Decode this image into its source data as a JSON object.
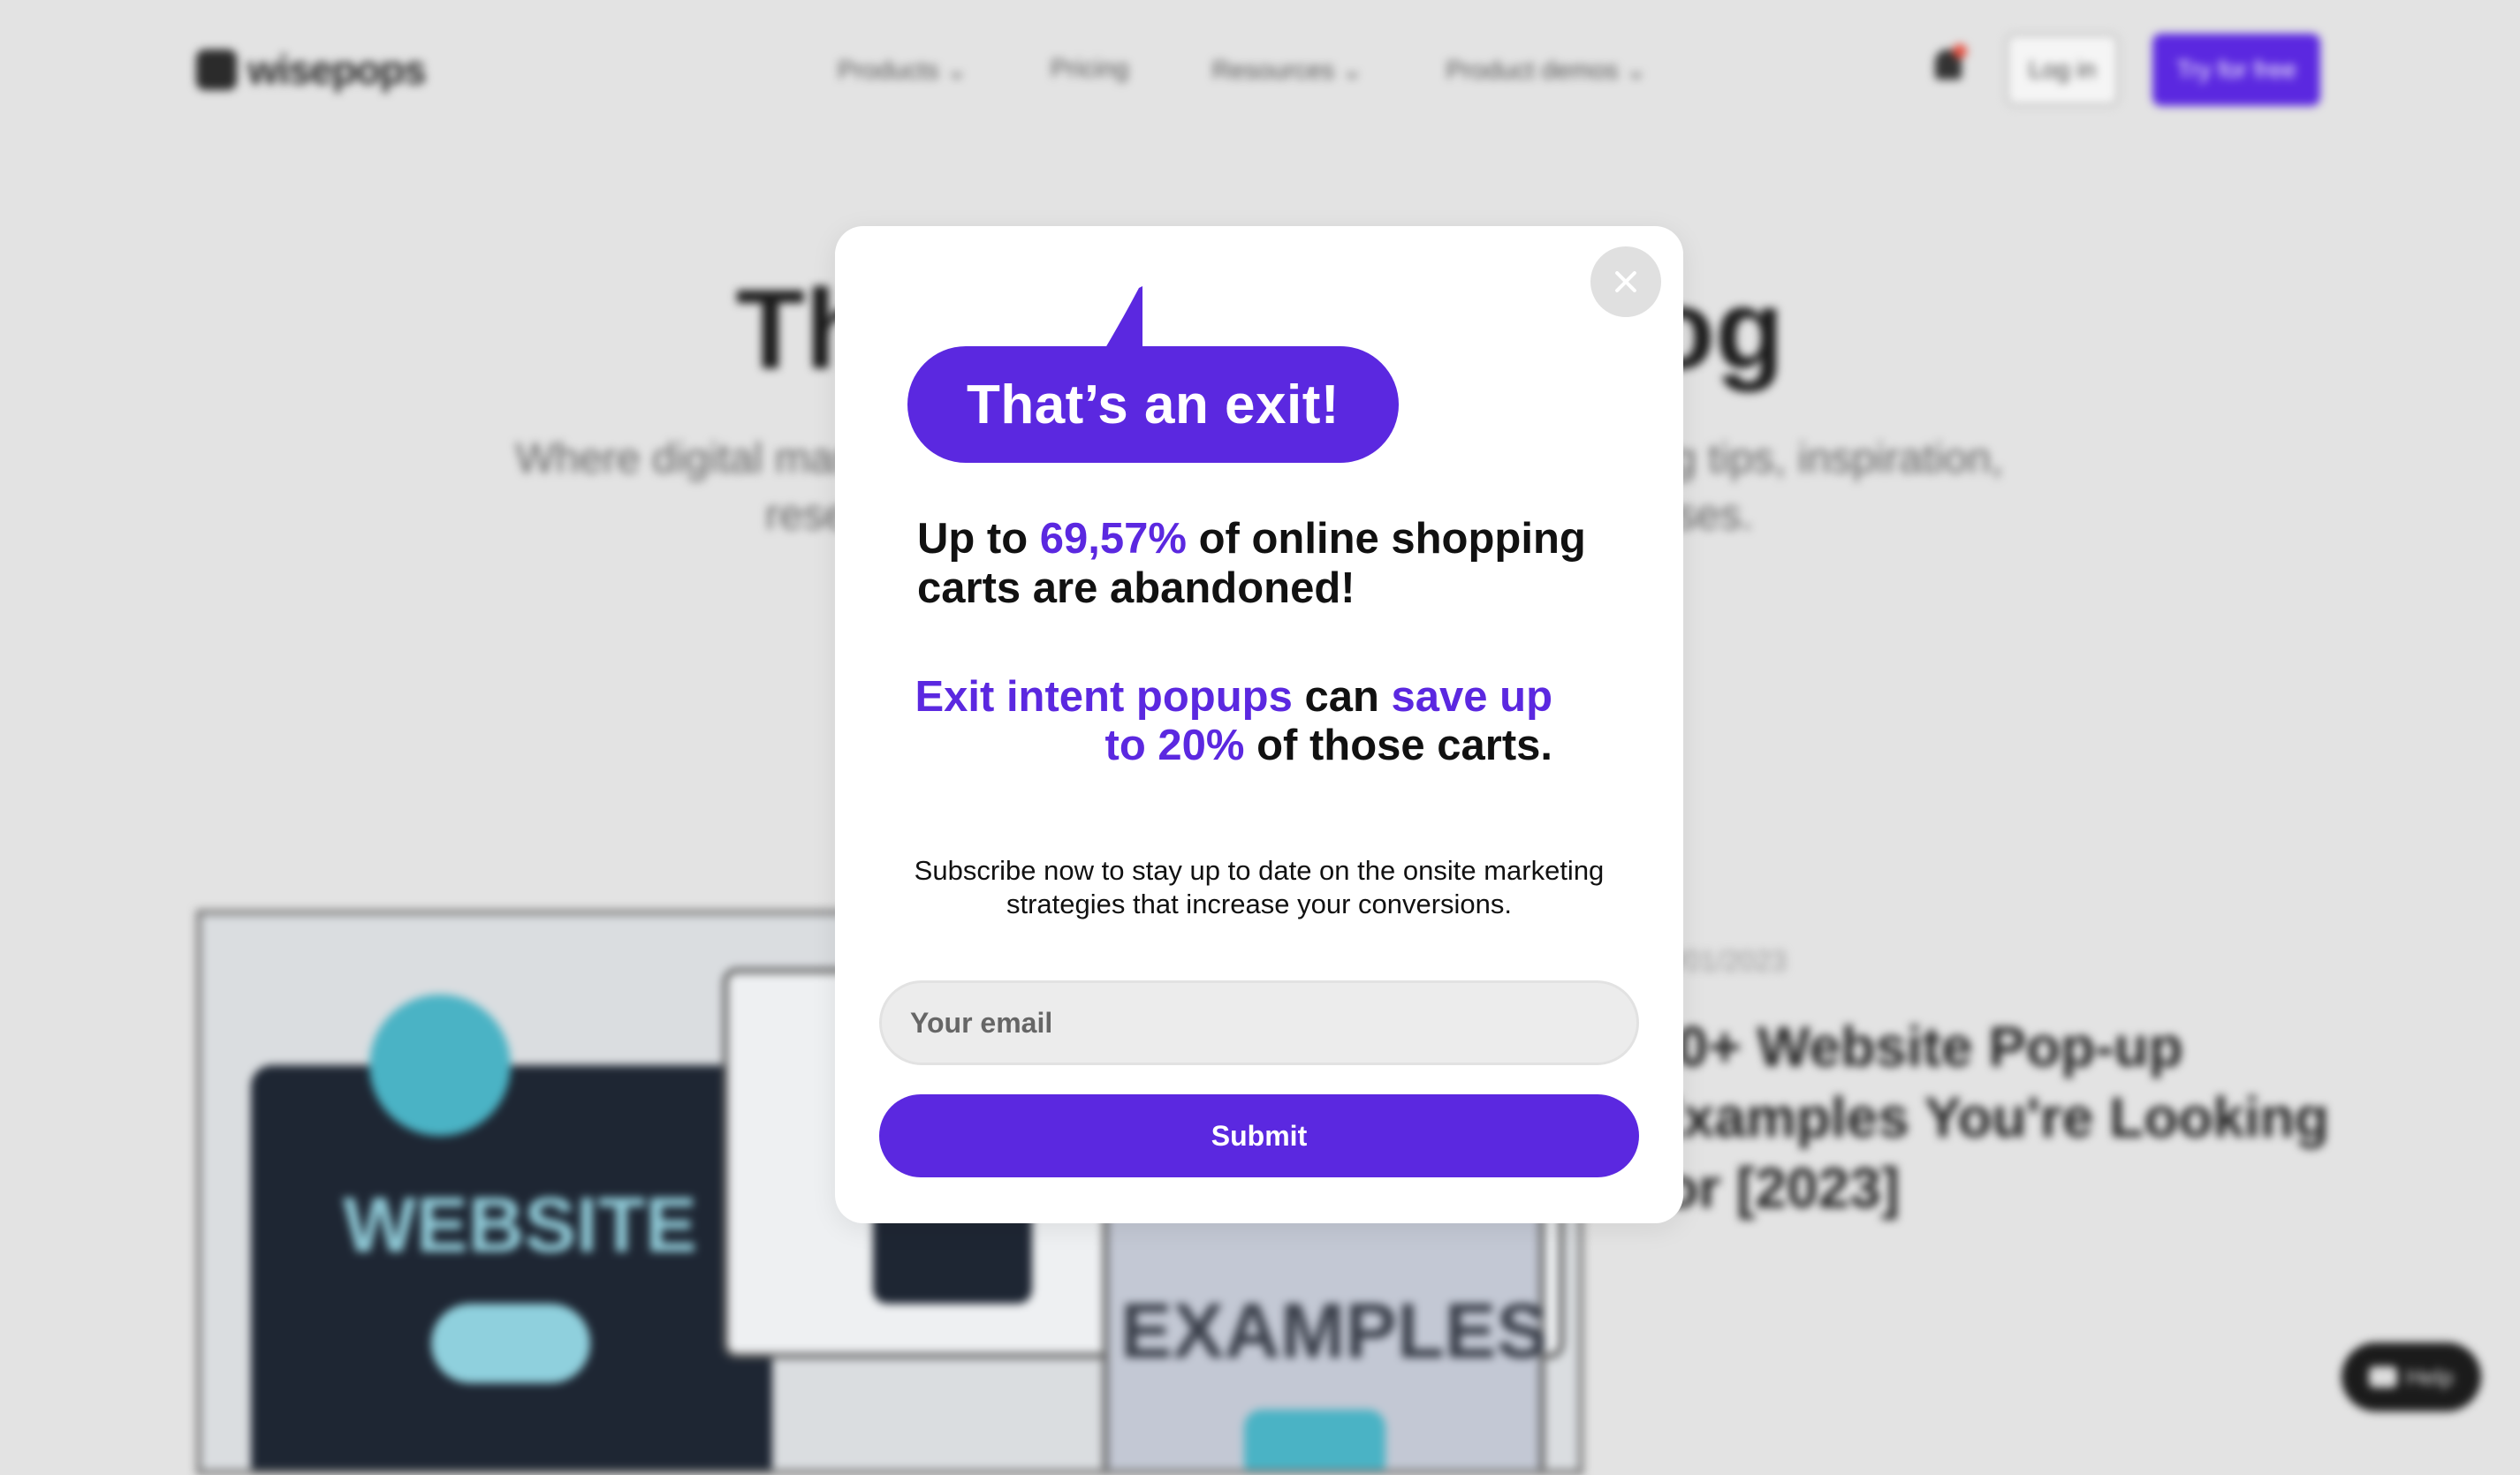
{
  "background": {
    "logo_text": "wisepops",
    "nav": [
      "Products ⌄",
      "Pricing",
      "Resources ⌄",
      "Product demos ⌄"
    ],
    "login_label": "Log in",
    "try_label": "Try for free",
    "hero_title": "The Wisepops Blog",
    "hero_subtitle": "Where digital marketers come for the freshest onsite marketing tips, inspiration, research, and case studies to grow their businesses.",
    "card_image_text_1": "WEBSITE",
    "card_image_text_2": "EXAMPLES",
    "post_date": "03/01/2023",
    "post_title": "80+ Website Pop-up Examples You're Looking for [2023]",
    "help_label": "Help"
  },
  "popup": {
    "bubble_text": "That’s an exit!",
    "stat_prefix": "Up to ",
    "stat_highlight": "69,57%",
    "stat_suffix": " of online shopping carts are abandoned!",
    "save_highlight_1": "Exit intent popups",
    "save_middle": " can ",
    "save_highlight_2": "save up to 20%",
    "save_suffix": " of those carts.",
    "subscribe_text": "Subscribe now to stay up to date on the onsite marketing strategies that increase your conversions.",
    "email_placeholder": "Your email",
    "email_value": "",
    "submit_label": "Submit",
    "close_icon": "close-icon"
  },
  "colors": {
    "accent": "#5b28e0",
    "overlay_bg": "#e3e3e3",
    "close_bg": "#e0e0e0"
  }
}
